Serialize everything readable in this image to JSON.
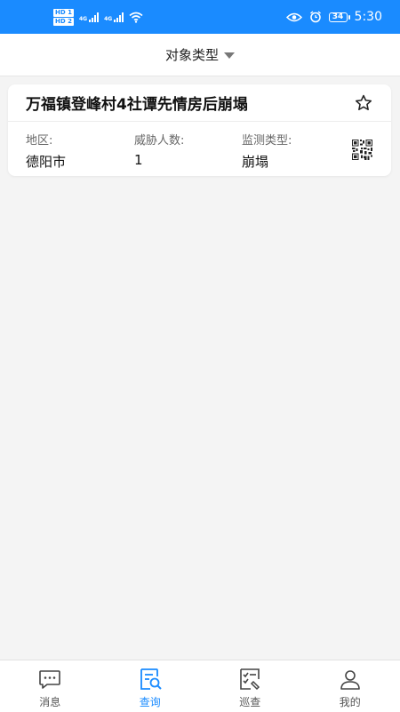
{
  "status_bar": {
    "hd1": "HD 1",
    "hd2": "HD 2",
    "network1": "4G",
    "network2": "4G",
    "battery": "34",
    "time": "5:30"
  },
  "header": {
    "filter_label": "对象类型"
  },
  "card": {
    "title": "万福镇登峰村4社谭先情房后崩塌",
    "fields": [
      {
        "label": "地区:",
        "value": "德阳市"
      },
      {
        "label": "威胁人数:",
        "value": "1"
      },
      {
        "label": "监测类型:",
        "value": "崩塌"
      }
    ]
  },
  "nav": {
    "items": [
      {
        "label": "消息",
        "icon": "chat-icon"
      },
      {
        "label": "查询",
        "icon": "search-doc-icon"
      },
      {
        "label": "巡查",
        "icon": "checklist-icon"
      },
      {
        "label": "我的",
        "icon": "user-icon"
      }
    ],
    "active_index": 1
  },
  "colors": {
    "accent": "#1a8bff",
    "background": "#f4f4f4"
  }
}
